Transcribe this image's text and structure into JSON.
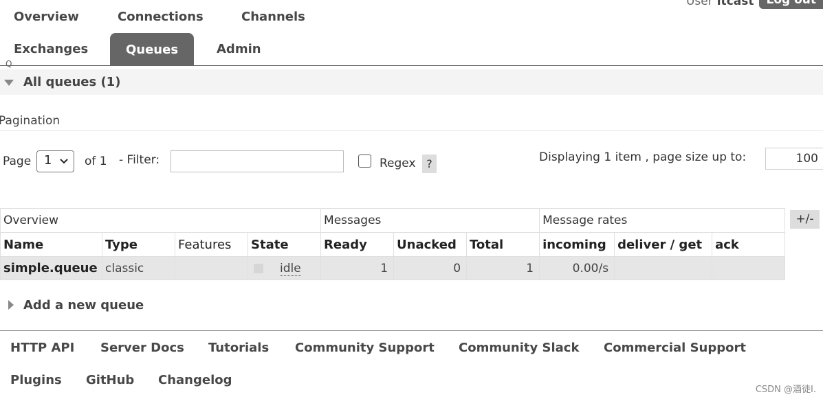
{
  "user": {
    "label": "User",
    "name": "itcast",
    "logout_label": "Log out"
  },
  "nav": {
    "row1": [
      "Overview",
      "Connections",
      "Channels"
    ],
    "row2": [
      "Exchanges",
      "Queues",
      "Admin"
    ]
  },
  "section": {
    "title": "All queues (1)",
    "stray": "Q"
  },
  "pagination": {
    "title": "Pagination",
    "page_label": "Page",
    "page_value": "1",
    "of_label": "of 1",
    "filter_label": "- Filter:",
    "filter_value": "",
    "regex_label": "Regex",
    "help_label": "?",
    "display_label": "Displaying 1 item , page size up to:",
    "page_size": "100"
  },
  "table": {
    "groups": [
      "Overview",
      "Messages",
      "Message rates"
    ],
    "columns": [
      "Name",
      "Type",
      "Features",
      "State",
      "Ready",
      "Unacked",
      "Total",
      "incoming",
      "deliver / get",
      "ack"
    ],
    "rows": [
      {
        "name": "simple.queue",
        "type": "classic",
        "features": "",
        "state": "idle",
        "ready": "1",
        "unacked": "0",
        "total": "1",
        "incoming": "0.00/s",
        "deliver_get": "",
        "ack": ""
      }
    ],
    "toggle_label": "+/-"
  },
  "add_queue": {
    "label": "Add a new queue"
  },
  "footer": {
    "row1": [
      "HTTP API",
      "Server Docs",
      "Tutorials",
      "Community Support",
      "Community Slack",
      "Commercial Support"
    ],
    "row2": [
      "Plugins",
      "GitHub",
      "Changelog"
    ]
  },
  "watermark": "CSDN @酒徒I."
}
